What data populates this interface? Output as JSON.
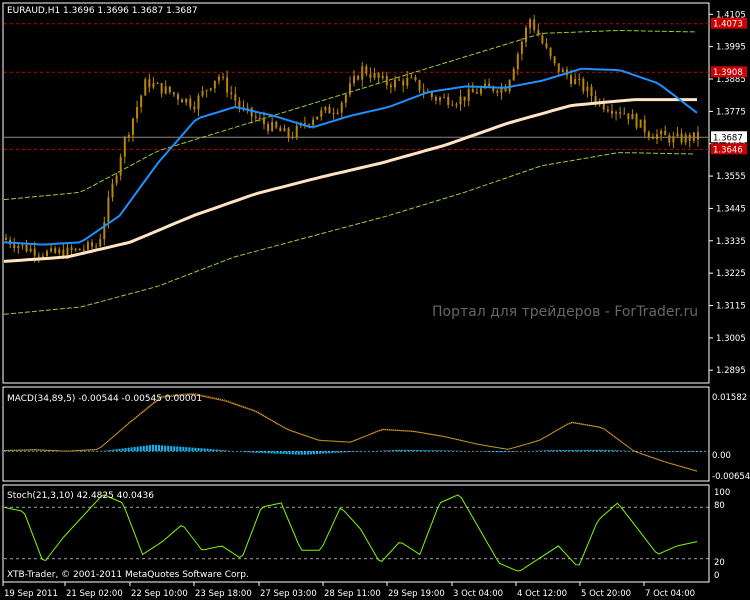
{
  "main": {
    "header": "EURAUD,H1  1.3696  1.3696  1.3687  1.3687",
    "watermark": "Портал для трейдеров - ForTrader.ru",
    "price_labels": [
      "1.4105",
      "1.3995",
      "1.3885",
      "1.3775",
      "1.3665",
      "1.3555",
      "1.3445",
      "1.3335",
      "1.3225",
      "1.3115",
      "1.3005",
      "1.2895"
    ],
    "badges": [
      {
        "text": "1.4073",
        "value": 1.4073,
        "bg": "#cc0000",
        "fg": "#ffffff"
      },
      {
        "text": "1.3908",
        "value": 1.3908,
        "bg": "#cc0000",
        "fg": "#ffffff"
      },
      {
        "text": "1.3687",
        "value": 1.3687,
        "bg": "#ffffff",
        "fg": "#000000"
      },
      {
        "text": "1.3646",
        "value": 1.3646,
        "bg": "#cc0000",
        "fg": "#ffffff"
      }
    ]
  },
  "macd": {
    "header": "MACD(34,89,5) -0.00544 -0.00545 0.00001",
    "labels": [
      "0.01582",
      "0.00",
      "-0.00654"
    ]
  },
  "stoch": {
    "header": "Stoch(21,3,10) 42.4825 40.0436",
    "labels": [
      "100",
      "80",
      "20",
      "0"
    ],
    "levels": [
      80,
      20
    ]
  },
  "copyright": "XTB-Trader, © 2001-2011 MetaQuotes Software Corp.",
  "time_labels": [
    "19 Sep 2011",
    "21 Sep 02:00",
    "22 Sep 10:00",
    "23 Sep 18:00",
    "27 Sep 03:00",
    "28 Sep 11:00",
    "29 Sep 19:00",
    "3 Oct 04:00",
    "4 Oct 12:00",
    "5 Oct 20:00",
    "7 Oct 04:00"
  ],
  "colors": {
    "background": "#000000",
    "grid": "#ffffff",
    "candle": "#b8860b",
    "ma_fast": "#1e90ff",
    "ma_slow": "#ffe4c4",
    "envelope": "#9acd32",
    "macd_hist": "#00bfff",
    "macd_signal": "#d2691e",
    "stoch": "#7cfc00",
    "levels": "#cc0000"
  },
  "chart_data": [
    {
      "type": "candlestick",
      "symbol": "EURAUD",
      "timeframe": "H1",
      "ylim": [
        1.2855,
        1.414
      ],
      "last_close": 1.3687,
      "horizontal_levels": [
        1.4073,
        1.3908,
        1.3646
      ],
      "price_path_approx": [
        1.3345,
        1.331,
        1.329,
        1.33,
        1.332,
        1.365,
        1.3875,
        1.384,
        1.38,
        1.39,
        1.378,
        1.373,
        1.369,
        1.376,
        1.379,
        1.392,
        1.387,
        1.388,
        1.382,
        1.3815,
        1.385,
        1.386,
        1.409,
        1.393,
        1.387,
        1.38,
        1.377,
        1.37,
        1.368,
        1.3687
      ],
      "ma_fast_approx": [
        1.333,
        1.3322,
        1.333,
        1.342,
        1.36,
        1.375,
        1.379,
        1.376,
        1.372,
        1.376,
        1.379,
        1.384,
        1.386,
        1.3855,
        1.388,
        1.392,
        1.3915,
        1.387,
        1.377
      ],
      "ma_slow_approx": [
        1.3265,
        1.328,
        1.333,
        1.342,
        1.3495,
        1.355,
        1.36,
        1.366,
        1.3735,
        1.3795,
        1.3815,
        1.3815
      ],
      "envelope_upper_approx": [
        1.3475,
        1.35,
        1.364,
        1.372,
        1.38,
        1.388,
        1.396,
        1.404,
        1.405,
        1.4045
      ],
      "envelope_lower_approx": [
        1.3085,
        1.311,
        1.318,
        1.328,
        1.335,
        1.342,
        1.35,
        1.359,
        1.3635,
        1.363
      ]
    },
    {
      "type": "line",
      "name": "MACD(34,89,5)",
      "ylim": [
        -0.008,
        0.017
      ],
      "values_current": {
        "macd": -0.00544,
        "signal": -0.00545,
        "histogram": 1e-05
      },
      "signal_path_approx": [
        0.0002,
        0.0004,
        0.0,
        0.0005,
        0.008,
        0.015,
        0.0158,
        0.014,
        0.011,
        0.006,
        0.003,
        0.0025,
        0.006,
        0.0055,
        0.004,
        0.002,
        0.0005,
        0.003,
        0.008,
        0.0065,
        0.0,
        -0.003,
        -0.0055
      ],
      "histogram_approx": [
        0.0001,
        0.0001,
        0.0001,
        0.0018,
        0.0008,
        -0.0004,
        -0.001,
        -0.0002,
        0.0004,
        0.0002,
        -0.0003,
        0.0003,
        0.0004,
        -0.0001,
        -0.0002
      ]
    },
    {
      "type": "line",
      "name": "Stoch(21,3,10)",
      "ylim": [
        0,
        100
      ],
      "values_current": {
        "main": 42.4825,
        "signal": 40.0436
      },
      "path_approx": [
        80,
        75,
        15,
        45,
        70,
        95,
        85,
        25,
        40,
        60,
        30,
        35,
        20,
        80,
        85,
        30,
        30,
        80,
        55,
        15,
        40,
        25,
        85,
        95,
        55,
        15,
        5,
        20,
        35,
        10,
        65,
        85,
        55,
        25,
        35,
        40
      ]
    }
  ]
}
